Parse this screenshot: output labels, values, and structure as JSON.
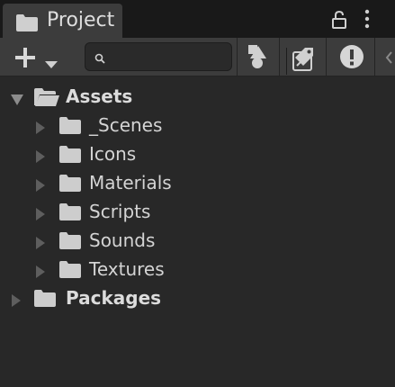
{
  "tab": {
    "title": "Project",
    "icon": "folder-icon"
  },
  "tab_actions": {
    "lock_icon": "lock-icon",
    "menu_icon": "more-vertical-icon"
  },
  "toolbar": {
    "add_icon": "plus-icon",
    "add_dropdown_icon": "caret-down-icon",
    "search": {
      "value": "",
      "placeholder": ""
    },
    "search_window_icon": "open-search-window-icon",
    "filter_type_icon": "shapes-icon",
    "filter_label_icon": "tag-icon",
    "filter_warning_icon": "exclamation-icon"
  },
  "tree": {
    "root": {
      "label": "Assets",
      "expanded": true,
      "children": [
        {
          "label": "_Scenes"
        },
        {
          "label": "Icons"
        },
        {
          "label": "Materials"
        },
        {
          "label": "Scripts"
        },
        {
          "label": "Sounds"
        },
        {
          "label": "Textures"
        }
      ]
    },
    "packages": {
      "label": "Packages",
      "expanded": false
    }
  },
  "colors": {
    "panel_bg": "#282828",
    "tabbar_bg": "#191919",
    "tab_bg": "#3c3c3c",
    "toolbar_bg": "#3c3c3c",
    "text": "#d2d2d2",
    "icon": "#c8c8c8"
  }
}
